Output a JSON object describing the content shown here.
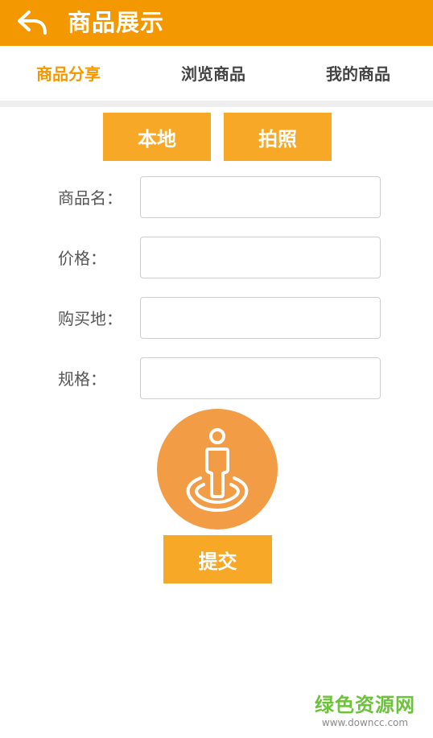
{
  "header": {
    "title": "商品展示",
    "back_icon": "back-arrow-icon"
  },
  "tabs": [
    {
      "label": "商品分享",
      "active": true
    },
    {
      "label": "浏览商品",
      "active": false
    },
    {
      "label": "我的商品",
      "active": false
    }
  ],
  "image_source": {
    "local_label": "本地",
    "camera_label": "拍照"
  },
  "form": {
    "fields": [
      {
        "label": "商品名：",
        "value": "",
        "placeholder": ""
      },
      {
        "label": "价格：",
        "value": "",
        "placeholder": ""
      },
      {
        "label": "购买地：",
        "value": "",
        "placeholder": ""
      },
      {
        "label": "规格：",
        "value": "",
        "placeholder": ""
      }
    ]
  },
  "avatar": {
    "icon": "person-location-icon"
  },
  "submit": {
    "label": "提交"
  },
  "watermark": {
    "main": "绿色资源网",
    "sub": "www.downcc.com"
  },
  "colors": {
    "accent": "#f39800",
    "button": "#f8a827",
    "avatar_bg": "#f29c46",
    "watermark": "#6cc23a"
  }
}
